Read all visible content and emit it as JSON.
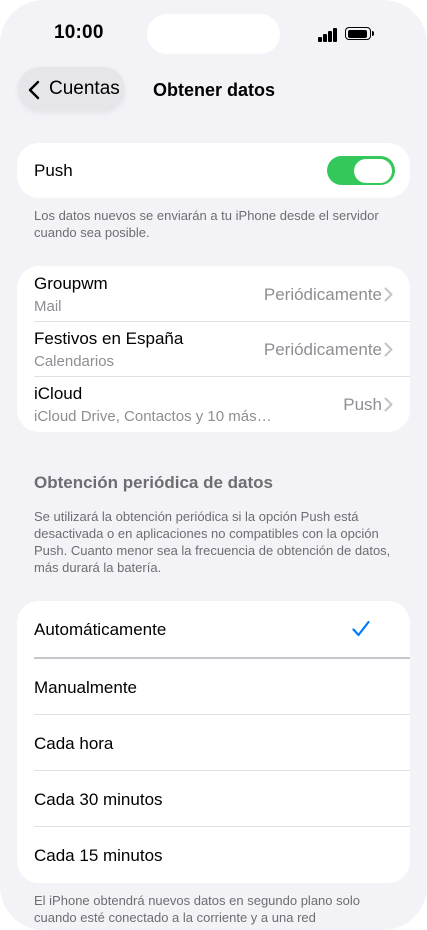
{
  "status_bar": {
    "time": "10:00"
  },
  "nav": {
    "back_label": "Cuentas",
    "title": "Obtener datos"
  },
  "push": {
    "label": "Push",
    "enabled": true,
    "footnote": "Los datos nuevos se enviarán a tu iPhone desde el servidor cuando sea posible."
  },
  "accounts": [
    {
      "name": "Groupwm",
      "subtitle": "Mail",
      "value": "Periódicamente"
    },
    {
      "name": "Festivos en España",
      "subtitle": "Calendarios",
      "value": "Periódicamente"
    },
    {
      "name": "iCloud",
      "subtitle": "iCloud Drive, Contactos y 10 más…",
      "value": "Push"
    }
  ],
  "periodic": {
    "header": "Obtención periódica de datos",
    "description": "Se utilizará la obtención periódica si la opción Push está desactivada o en aplicaciones no compatibles con la opción Push. Cuanto menor sea la frecuencia de obtención de datos, más durará la batería.",
    "options": [
      "Automáticamente",
      "Manualmente",
      "Cada hora",
      "Cada 30 minutos",
      "Cada 15 minutos"
    ],
    "selected": "Automáticamente",
    "footer": "El iPhone obtendrá nuevos datos en segundo plano solo cuando esté conectado a la corriente y a una red"
  },
  "colors": {
    "accent": "#007aff",
    "toggle_on": "#34c759",
    "background": "#f2f2f7"
  }
}
